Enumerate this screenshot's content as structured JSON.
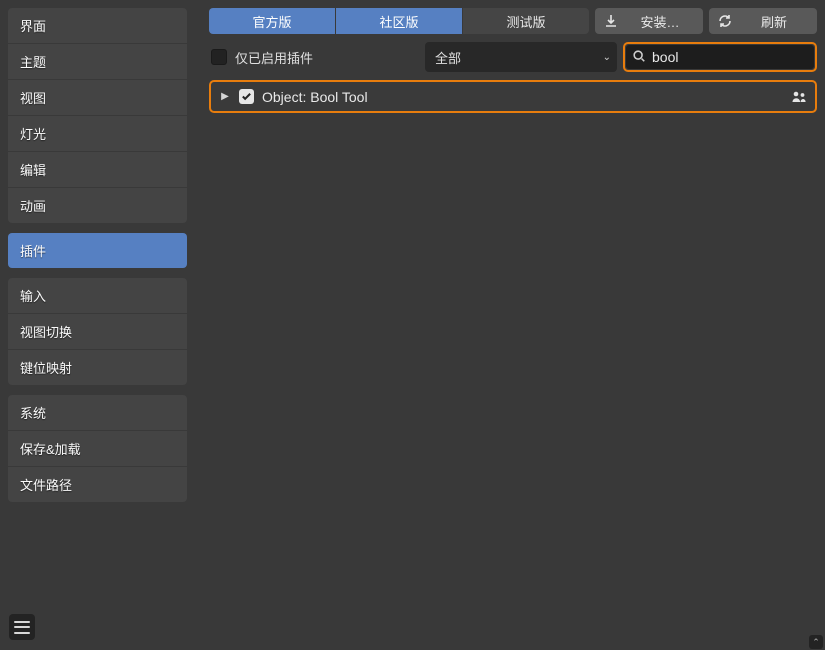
{
  "sidebar": {
    "groups": [
      {
        "items": [
          {
            "label": "界面",
            "key": "interface"
          },
          {
            "label": "主题",
            "key": "themes"
          },
          {
            "label": "视图",
            "key": "viewport"
          },
          {
            "label": "灯光",
            "key": "lights"
          },
          {
            "label": "编辑",
            "key": "editing"
          },
          {
            "label": "动画",
            "key": "animation"
          }
        ]
      },
      {
        "items": [
          {
            "label": "插件",
            "key": "addons",
            "active": true
          }
        ]
      },
      {
        "items": [
          {
            "label": "输入",
            "key": "input"
          },
          {
            "label": "视图切换",
            "key": "navigation"
          },
          {
            "label": "键位映射",
            "key": "keymap"
          }
        ]
      },
      {
        "items": [
          {
            "label": "系统",
            "key": "system"
          },
          {
            "label": "保存&加载",
            "key": "saveload"
          },
          {
            "label": "文件路径",
            "key": "filepaths"
          }
        ]
      }
    ]
  },
  "tabs": {
    "official": "官方版",
    "community": "社区版",
    "testing": "测试版"
  },
  "buttons": {
    "install": "安装…",
    "refresh": "刷新"
  },
  "filter": {
    "enabled_only": "仅已启用插件",
    "category": "全部"
  },
  "search": {
    "value": "bool"
  },
  "addons": [
    {
      "name": "Object: Bool Tool",
      "enabled": true
    }
  ]
}
